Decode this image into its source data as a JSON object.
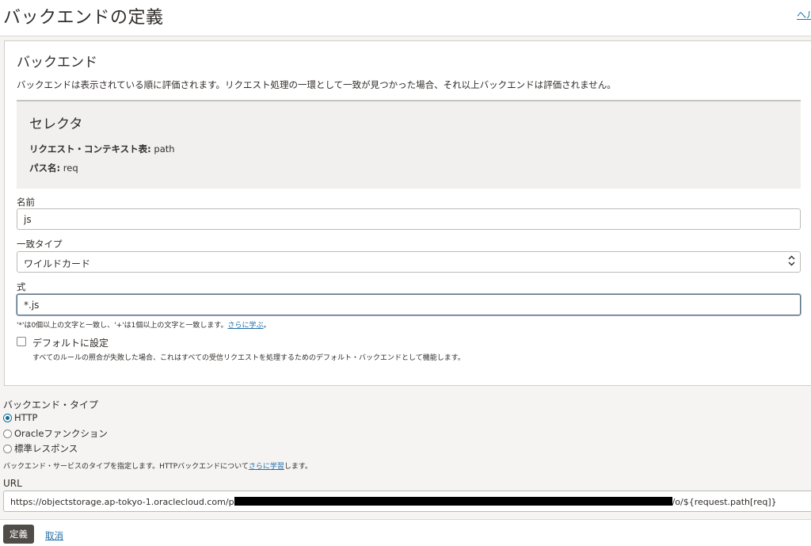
{
  "header": {
    "title": "バックエンドの定義",
    "help_link": "ヘル"
  },
  "backend": {
    "title": "バックエンド",
    "description": "バックエンドは表示されている順に評価されます。リクエスト処理の一環として一致が見つかった場合、それ以上バックエンドは評価されません。",
    "selector": {
      "title": "セレクタ",
      "context_label": "リクエスト・コンテキスト表:",
      "context_value": "path",
      "path_label": "パス名:",
      "path_value": "req"
    },
    "name": {
      "label": "名前",
      "value": "js"
    },
    "match_type": {
      "label": "一致タイプ",
      "value": "ワイルドカード"
    },
    "expression": {
      "label": "式",
      "value": "*.js",
      "hint": "'*'は0個以上の文字と一致し、'+'は1個以上の文字と一致します。",
      "hint_link": "さらに学ぶ",
      "hint_end": "。"
    },
    "default": {
      "label": "デフォルトに設定",
      "checked": false,
      "help": "すべてのルールの照合が失敗した場合、これはすべての受信リクエストを処理するためのデフォルト・バックエンドとして機能します。"
    }
  },
  "backend_type": {
    "label": "バックエンド・タイプ",
    "options": [
      "HTTP",
      "Oracleファンクション",
      "標準レスポンス"
    ],
    "selected": "HTTP",
    "help": "バックエンド・サービスのタイプを指定します。HTTPバックエンドについて",
    "help_link": "さらに学習",
    "help_end": "します。"
  },
  "url": {
    "label": "URL",
    "prefix": "https://objectstorage.ap-tokyo-1.oraclecloud.com/p",
    "suffix": "/o/${request.path[req]}"
  },
  "footer": {
    "define_label": "定義",
    "cancel_label": "取消"
  },
  "colors": {
    "primary_button": "#504c48",
    "link": "#1f6fa8",
    "radio_accent": "#0e6b8f"
  }
}
